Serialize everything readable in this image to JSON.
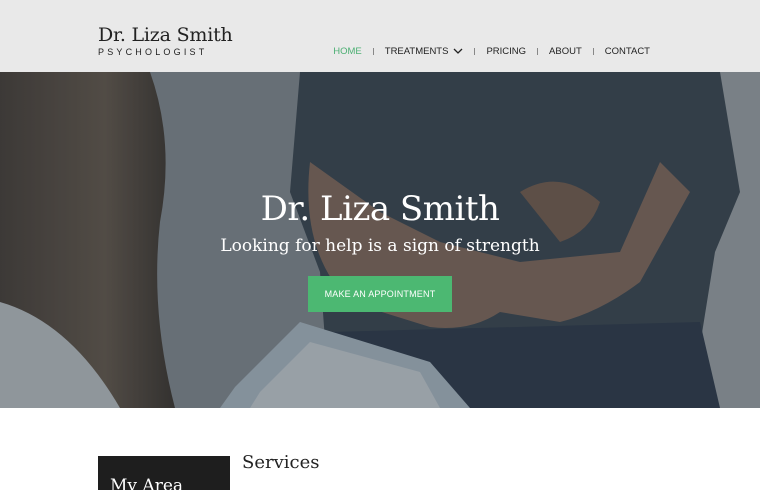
{
  "brand": {
    "name": "Dr. Liza Smith",
    "subtitle": "PSYCHOLOGIST"
  },
  "nav": {
    "items": [
      {
        "label": "HOME",
        "active": true
      },
      {
        "label": "TREATMENTS",
        "has_dropdown": true
      },
      {
        "label": "PRICING"
      },
      {
        "label": "ABOUT"
      },
      {
        "label": "CONTACT"
      }
    ]
  },
  "hero": {
    "title": "Dr. Liza Smith",
    "tagline": "Looking for help is a sign of strength",
    "cta_label": "MAKE AN APPOINTMENT"
  },
  "sections": {
    "area_title": "My Area",
    "services_title": "Services"
  },
  "colors": {
    "accent": "#4cb872",
    "header_bg": "#e9e9e9",
    "dark_box": "#1e1e1e"
  }
}
